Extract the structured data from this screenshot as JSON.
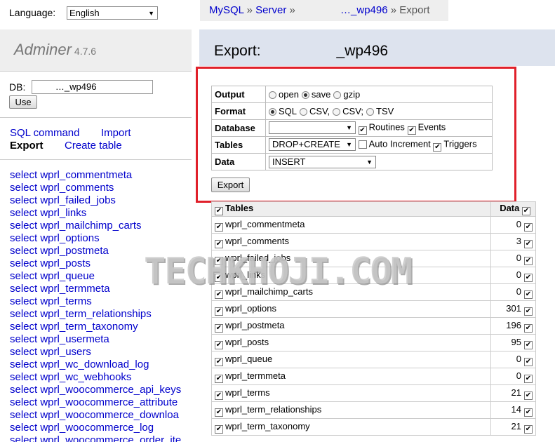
{
  "language": {
    "label": "Language:",
    "selected": "English"
  },
  "logo": {
    "name": "Adminer",
    "version": "4.7.6"
  },
  "db": {
    "label": "DB:",
    "value": "        …_wp496",
    "use_label": "Use"
  },
  "nav": {
    "sql_command": "SQL command",
    "import": "Import",
    "export": "Export",
    "create_table": "Create table"
  },
  "select_links": [
    "select wprl_commentmeta",
    "select wprl_comments",
    "select wprl_failed_jobs",
    "select wprl_links",
    "select wprl_mailchimp_carts",
    "select wprl_options",
    "select wprl_postmeta",
    "select wprl_posts",
    "select wprl_queue",
    "select wprl_termmeta",
    "select wprl_terms",
    "select wprl_term_relationships",
    "select wprl_term_taxonomy",
    "select wprl_usermeta",
    "select wprl_users",
    "select wprl_wc_download_log",
    "select wprl_wc_webhooks",
    "select wprl_woocommerce_api_keys",
    "select wprl_woocommerce_attribute",
    "select wprl_woocommerce_downloa",
    "select wprl_woocommerce_log",
    "select wprl_woocommerce_order_ite"
  ],
  "breadcrumb": {
    "mysql": "MySQL",
    "sep": "»",
    "server": "Server",
    "db": "…_wp496",
    "current": "Export"
  },
  "page_title": {
    "title": "Export:",
    "db": "_wp496"
  },
  "form": {
    "output": {
      "label": "Output",
      "options": [
        "open",
        "save",
        "gzip"
      ],
      "selected": "save"
    },
    "format": {
      "label": "Format",
      "options": [
        "SQL",
        "CSV,",
        "CSV;",
        "TSV"
      ],
      "selected": "SQL"
    },
    "database": {
      "label": "Database",
      "select_value": "",
      "routines": "Routines",
      "events": "Events"
    },
    "tables": {
      "label": "Tables",
      "select_value": "DROP+CREATE",
      "auto_increment": "Auto Increment",
      "triggers": "Triggers"
    },
    "data": {
      "label": "Data",
      "select_value": "INSERT"
    },
    "export_button": "Export"
  },
  "table_list": {
    "header_tables": "Tables",
    "header_data": "Data",
    "rows": [
      {
        "name": "wprl_commentmeta",
        "count": "0"
      },
      {
        "name": "wprl_comments",
        "count": "3"
      },
      {
        "name": "wprl_failed_jobs",
        "count": "0"
      },
      {
        "name": "wprl_links",
        "count": "0"
      },
      {
        "name": "wprl_mailchimp_carts",
        "count": "0"
      },
      {
        "name": "wprl_options",
        "count": "301"
      },
      {
        "name": "wprl_postmeta",
        "count": "196"
      },
      {
        "name": "wprl_posts",
        "count": "95"
      },
      {
        "name": "wprl_queue",
        "count": "0"
      },
      {
        "name": "wprl_termmeta",
        "count": "0"
      },
      {
        "name": "wprl_terms",
        "count": "21"
      },
      {
        "name": "wprl_term_relationships",
        "count": "14"
      },
      {
        "name": "wprl_term_taxonomy",
        "count": "21"
      }
    ]
  },
  "watermark": "TECHKHOJI.COM",
  "colors": {
    "link": "#0000cc",
    "highlight_box": "#e0202a",
    "header_bg": "#dde3ee"
  }
}
